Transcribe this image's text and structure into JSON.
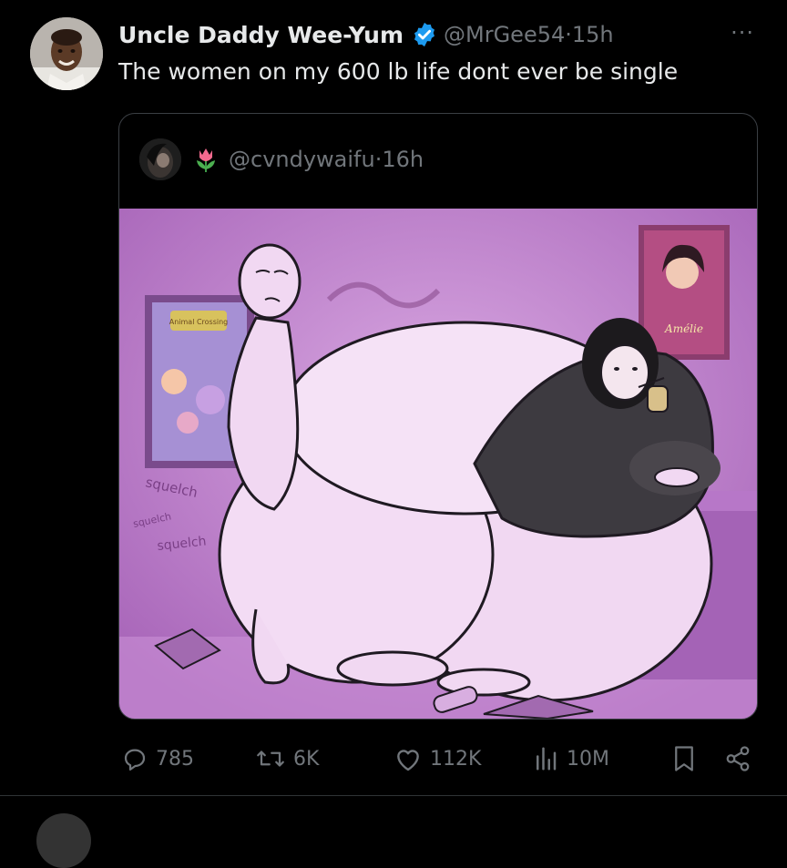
{
  "tweet": {
    "author_name": "Uncle Daddy Wee-Yum",
    "handle": "@MrGee54",
    "time_sep": " · ",
    "time": "15h",
    "text": "The women on my 600 lb life dont ever be single",
    "more_label": "···",
    "verified_color": "#1d9bf0"
  },
  "quote": {
    "handle": "@cvndywaifu",
    "time_sep": " · ",
    "time": "16h",
    "image_captions": [
      "squelch",
      "squelch",
      "squelch"
    ],
    "poster_titles": [
      "Animal Crossing",
      "Amélie"
    ]
  },
  "actions": {
    "replies": "785",
    "reposts": "6K",
    "likes": "112K",
    "views": "10M",
    "icons": [
      "reply-icon",
      "repost-icon",
      "like-icon",
      "views-icon",
      "bookmark-icon",
      "share-icon"
    ]
  },
  "colors": {
    "background": "#000000",
    "primary_text": "#e7e9ea",
    "secondary_text": "#71767b",
    "border": "#3b3f44",
    "illustration_bg": "#c98fd6"
  }
}
